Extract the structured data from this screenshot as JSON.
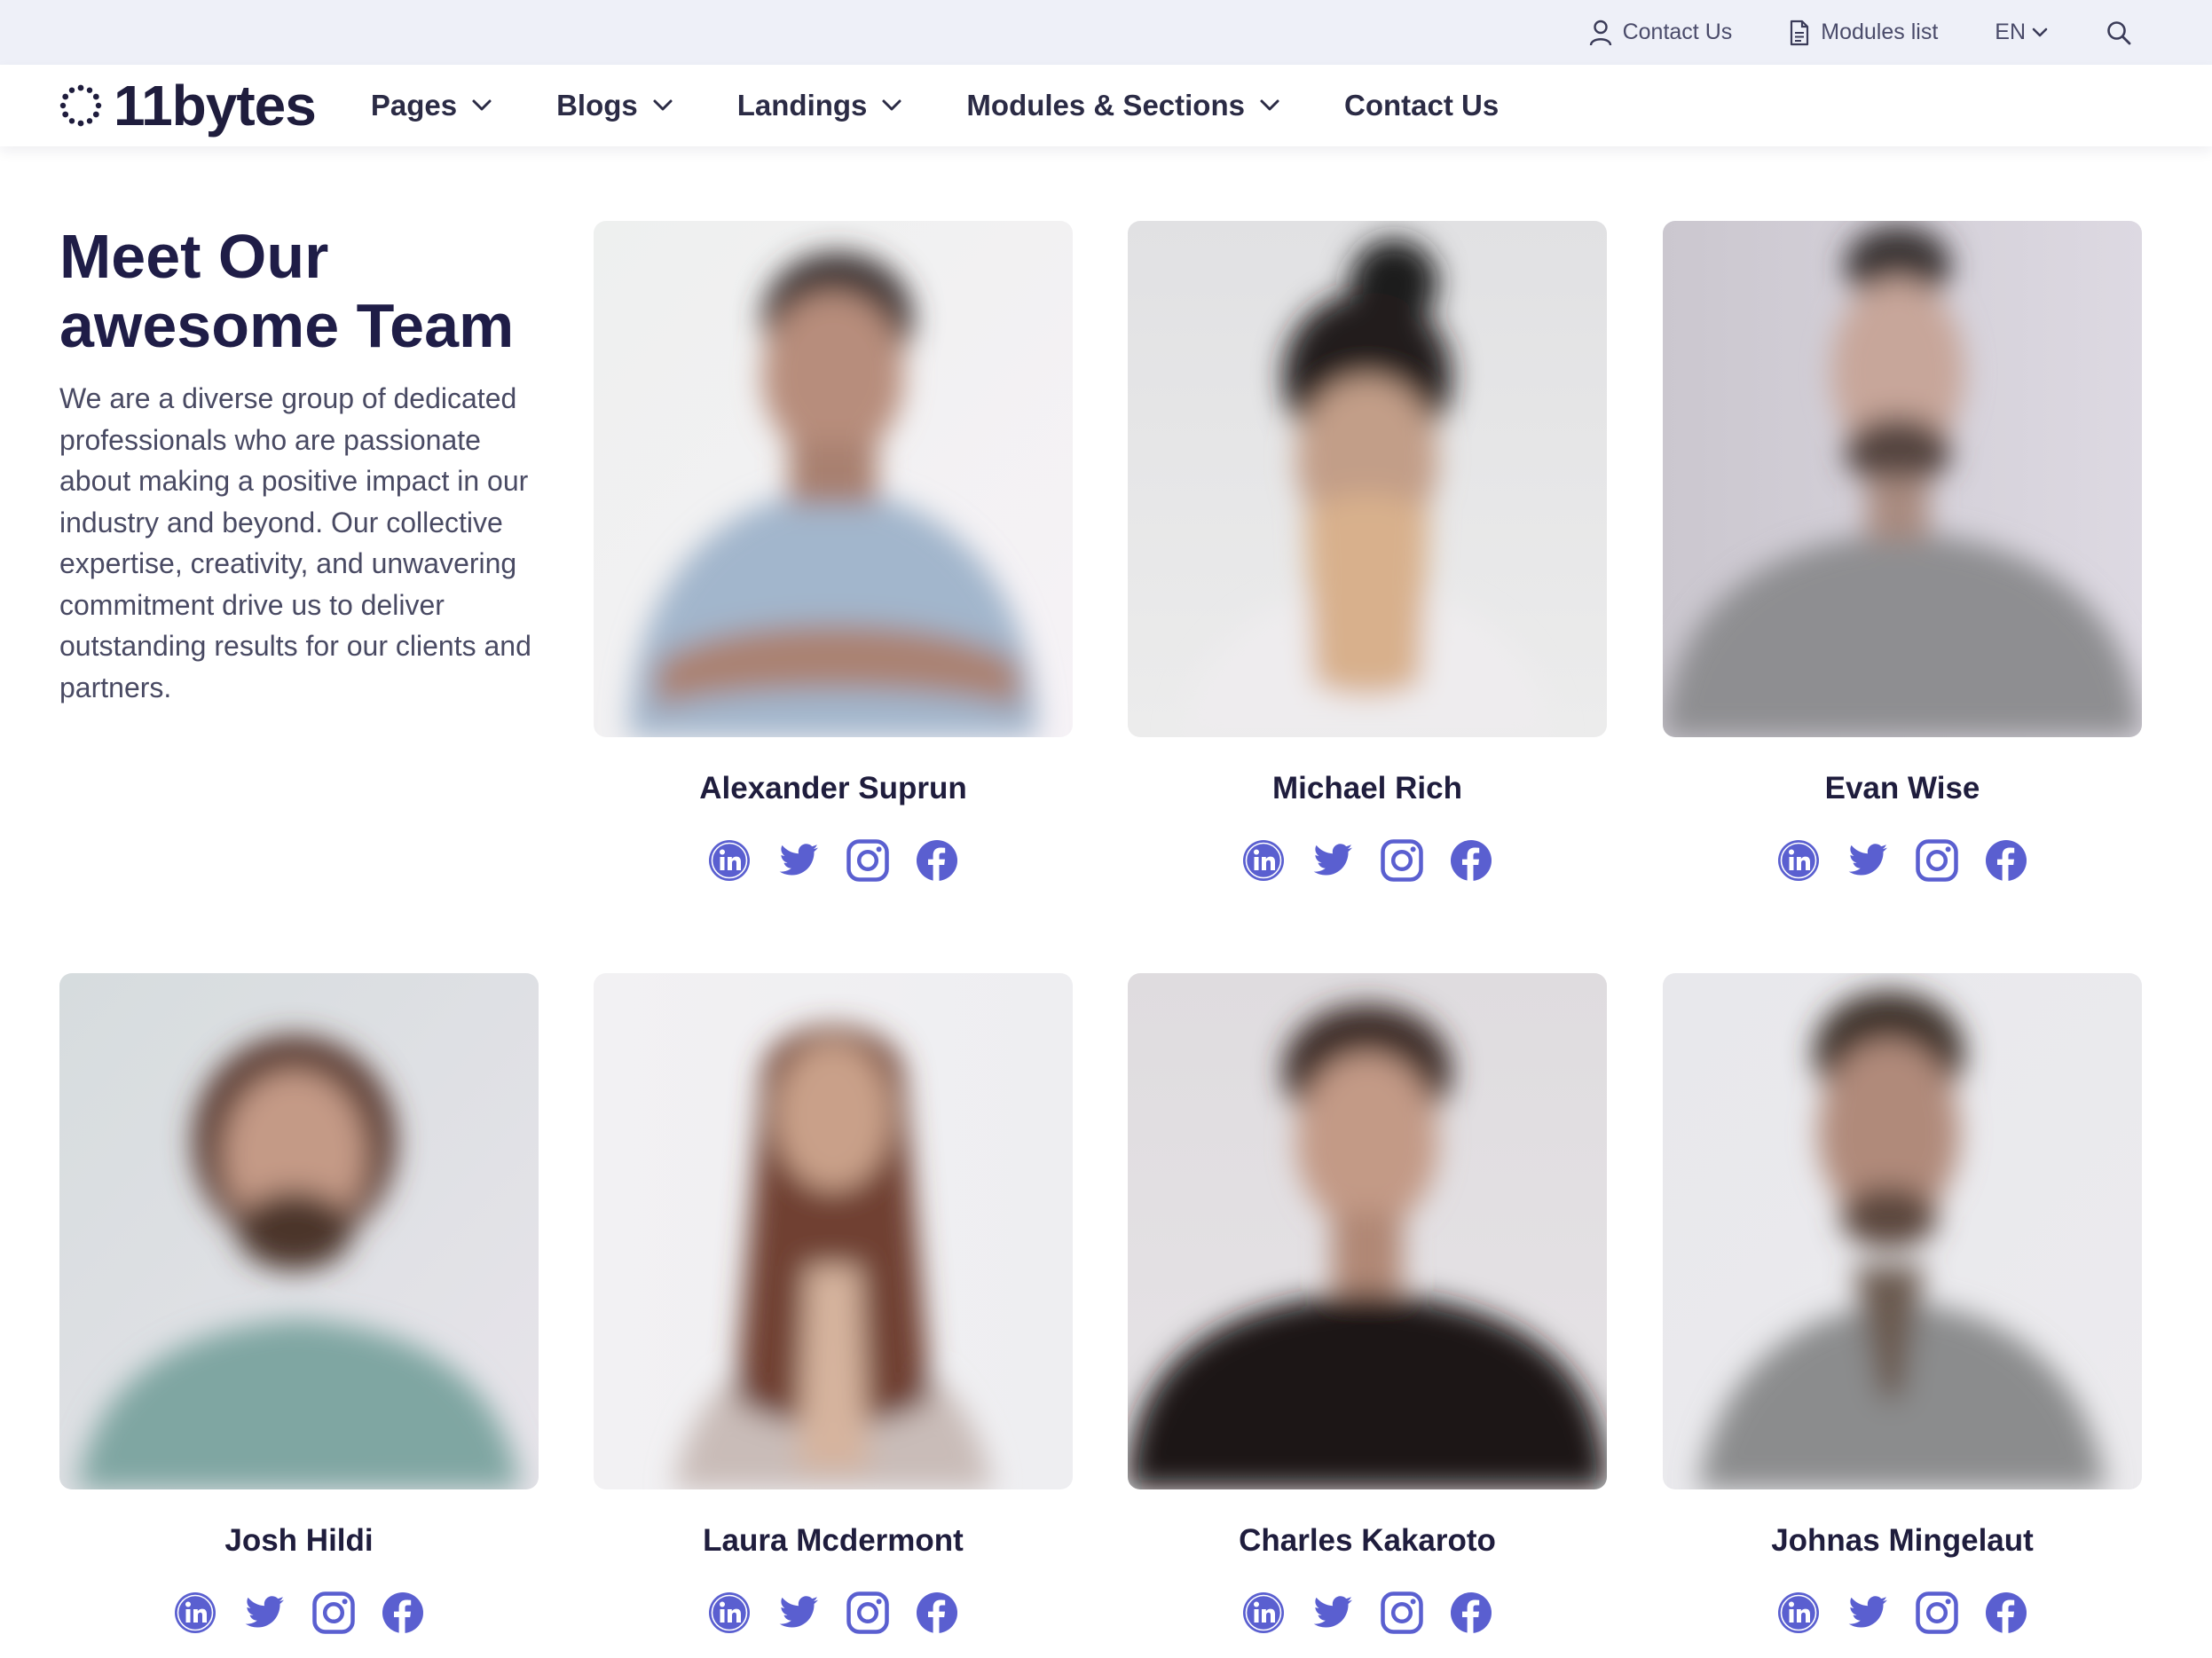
{
  "topbar": {
    "contact_label": "Contact Us",
    "modules_label": "Modules list",
    "language": "EN"
  },
  "header": {
    "logo_text": "11bytes",
    "nav": [
      {
        "label": "Pages",
        "dropdown": true
      },
      {
        "label": "Blogs",
        "dropdown": true
      },
      {
        "label": "Landings",
        "dropdown": true
      },
      {
        "label": "Modules & Sections",
        "dropdown": true
      },
      {
        "label": "Contact Us",
        "dropdown": false
      }
    ]
  },
  "intro": {
    "title_line1": "Meet Our",
    "title_line2": "awesome Team",
    "description": "We are a diverse group of dedicated professionals who are passionate about making a positive impact in our industry and beyond. Our collective expertise, creativity, and unwavering commitment drive us to deliver outstanding results for our clients and partners."
  },
  "team": [
    {
      "name": "Alexander Suprun"
    },
    {
      "name": "Michael Rich"
    },
    {
      "name": "Evan Wise"
    },
    {
      "name": "Josh Hildi"
    },
    {
      "name": "Laura Mcdermont"
    },
    {
      "name": "Charles Kakaroto"
    },
    {
      "name": "Johnas Mingelaut"
    }
  ],
  "colors": {
    "accent": "#5a5fd0",
    "heading": "#1f1d47",
    "topbar_bg": "#eef0f8"
  },
  "social_icons": [
    "linkedin-icon",
    "twitter-icon",
    "instagram-icon",
    "facebook-icon"
  ]
}
